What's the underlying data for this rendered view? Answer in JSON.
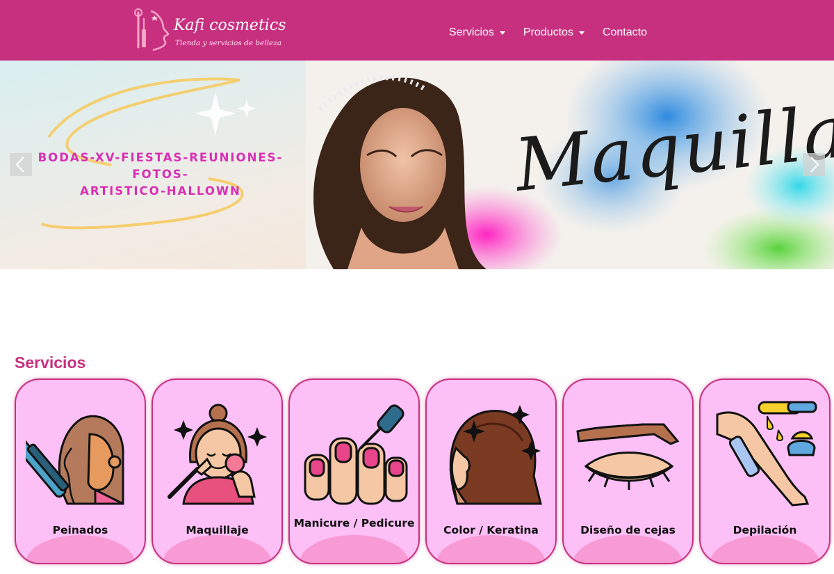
{
  "brand": {
    "name": "Kafi cosmetics",
    "tagline": "Tienda y servicios de belleza"
  },
  "nav": {
    "items": [
      {
        "label": "Servicios",
        "dropdown": true
      },
      {
        "label": "Productos",
        "dropdown": true
      },
      {
        "label": "Contacto",
        "dropdown": false
      }
    ]
  },
  "carousel": {
    "line1": "BODAS-XV-FIESTAS-REUNIONES-FOTOS-",
    "line2": "ARTISTICO-HALLOWN",
    "script": "Maquillaje",
    "prev_icon": "chevron-left-icon",
    "next_icon": "chevron-right-icon"
  },
  "services": {
    "title": "Servicios",
    "items": [
      {
        "label": "Peinados",
        "icon": "hair-straightener-icon"
      },
      {
        "label": "Maquillaje",
        "icon": "makeup-brush-face-icon"
      },
      {
        "label": "Manicure / Pedicure",
        "icon": "nail-polish-icon"
      },
      {
        "label": "Color / Keratina",
        "icon": "hair-color-icon"
      },
      {
        "label": "Diseño de cejas",
        "icon": "eyebrow-icon"
      },
      {
        "label": "Depilación",
        "icon": "wax-leg-icon"
      }
    ]
  },
  "colors": {
    "brand": "#c7307f",
    "card_bg": "#fcbff6",
    "card_wave": "#f89ad4",
    "carousel_text": "#d92fb4"
  }
}
